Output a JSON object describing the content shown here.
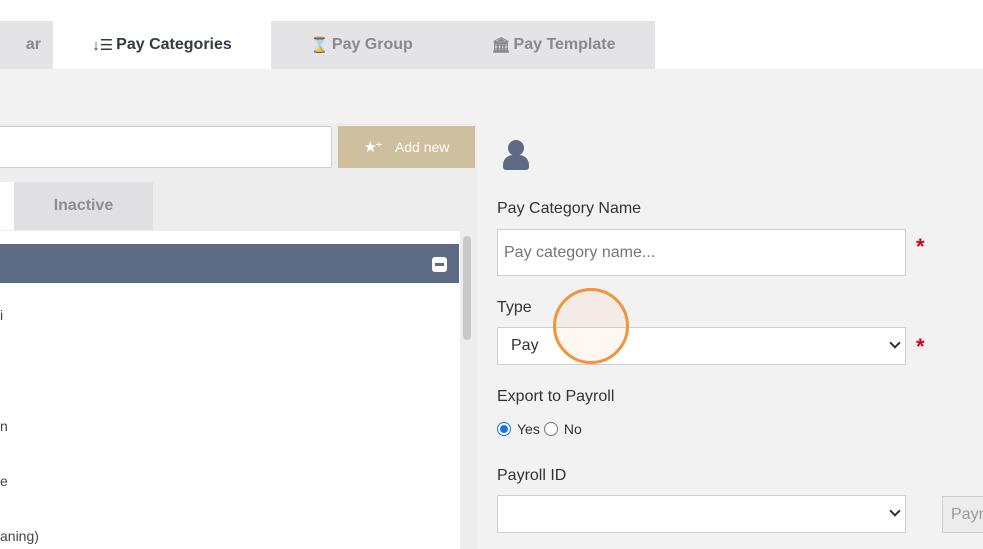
{
  "tabs": [
    {
      "label": "ar",
      "icon": "calendar-icon",
      "active": false
    },
    {
      "label": "Pay Categories",
      "icon": "sort-icon",
      "active": true
    },
    {
      "label": "Pay Group",
      "icon": "hourglass-icon",
      "active": false
    },
    {
      "label": "Pay Template",
      "icon": "bank-icon",
      "active": false
    }
  ],
  "left": {
    "search": {
      "value": "",
      "placeholder": ""
    },
    "add_button": {
      "label": "Add new",
      "icon": "star-plus-icon"
    },
    "status_tabs": {
      "active_label": "",
      "inactive_label": "Inactive"
    },
    "rows": [
      "i",
      "n",
      "e",
      "aning)"
    ]
  },
  "form": {
    "name_label": "Pay Category Name",
    "name_placeholder": "Pay category name...",
    "type_label": "Type",
    "type_value": "Pay",
    "export_label": "Export to Payroll",
    "export_yes": "Yes",
    "export_no": "No",
    "payroll_label": "Payroll ID",
    "payroll_value": "",
    "payroll_button": "Payroll",
    "required_mark": "*"
  },
  "colors": {
    "accent": "#cebf9e",
    "header_bar": "#5c6a84",
    "required": "#d0021b",
    "radio": "#1a73e8",
    "cursor": "#f0953a"
  }
}
